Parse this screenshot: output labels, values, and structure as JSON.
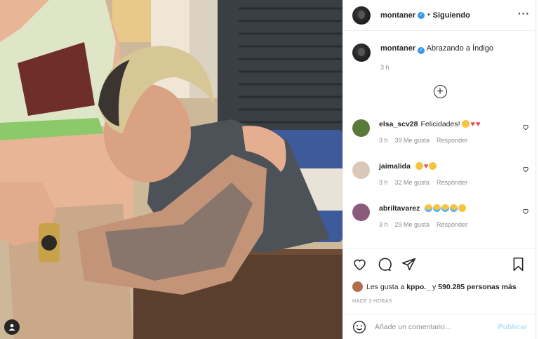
{
  "post": {
    "username": "montaner",
    "follow_status": "Siguiendo",
    "more_icon": "more-horizontal-icon",
    "verified_icon": "verified-badge-icon"
  },
  "caption": {
    "username": "montaner",
    "text": "Abrazando a Índigo",
    "time": "3 h"
  },
  "load_more_icon": "plus-circle-icon",
  "comments": [
    {
      "username": "elsa_scv28",
      "text": "Felicidades!",
      "time": "3 h",
      "likes": "39 Me gusta",
      "reply": "Responder",
      "avatar_color": "#5a7a3a",
      "emojis": [
        "blush",
        "heart",
        "heart"
      ]
    },
    {
      "username": "jaimalida",
      "text": "",
      "time": "3 h",
      "likes": "32 Me gusta",
      "reply": "Responder",
      "avatar_color": "#d9c8b8",
      "emojis": [
        "blush",
        "heart",
        "blush"
      ]
    },
    {
      "username": "abriltavarez",
      "text": "",
      "time": "3 h",
      "likes": "29 Me gusta",
      "reply": "Responder",
      "avatar_color": "#8a5b7a",
      "emojis": [
        "cry",
        "cry",
        "cry",
        "cry",
        "blush"
      ]
    }
  ],
  "actions": {
    "icons": [
      "heart-icon",
      "comment-icon",
      "share-icon",
      "bookmark-icon"
    ]
  },
  "likes": {
    "prefix": "Les gusta a",
    "first_user": "kppo._",
    "middle": "y",
    "count": "590.285 personas más"
  },
  "posted_ago": "HACE 3 HORAS",
  "add_comment": {
    "placeholder": "Añade un comentario...",
    "publish_label": "Publicar",
    "emoji_icon": "smiley-icon"
  },
  "colors": {
    "link_blue": "#3897f0",
    "publish_disabled": "#b2dffc",
    "heart_red": "#ed4956"
  }
}
